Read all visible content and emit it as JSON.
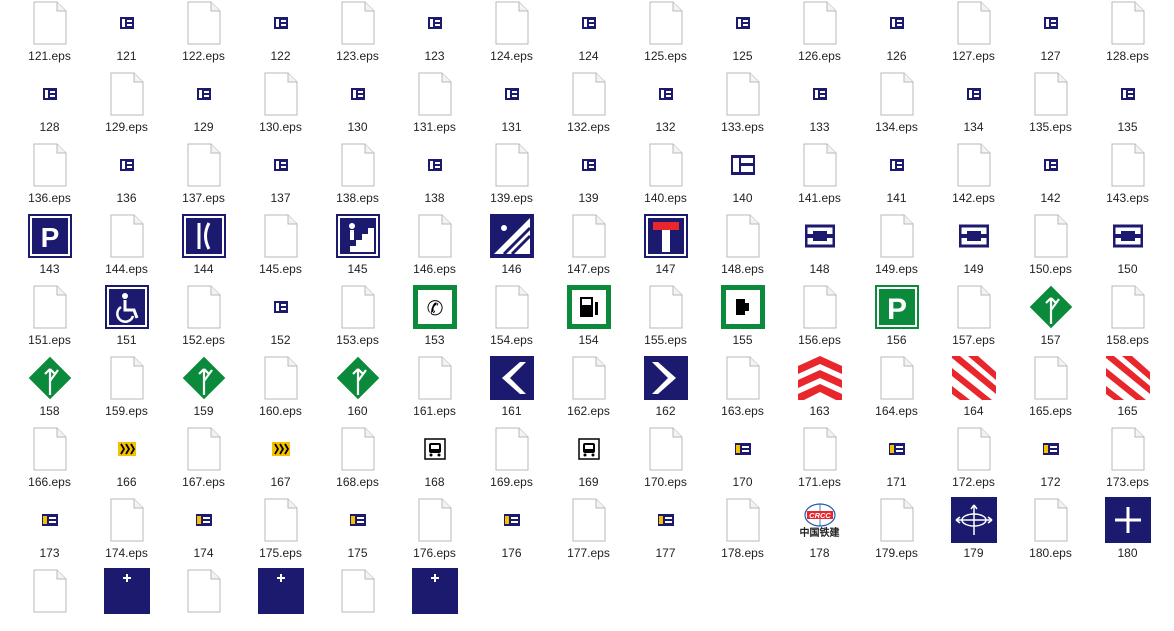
{
  "rows": [
    [
      {
        "l": "121.eps",
        "t": "file"
      },
      {
        "l": "121",
        "t": "smallnav"
      },
      {
        "l": "122.eps",
        "t": "file"
      },
      {
        "l": "122",
        "t": "smallnav"
      },
      {
        "l": "123.eps",
        "t": "file"
      },
      {
        "l": "123",
        "t": "smallnav"
      },
      {
        "l": "124.eps",
        "t": "file"
      },
      {
        "l": "124",
        "t": "smallnav"
      },
      {
        "l": "125.eps",
        "t": "file"
      },
      {
        "l": "125",
        "t": "smallnav"
      },
      {
        "l": "126.eps",
        "t": "file"
      },
      {
        "l": "126",
        "t": "smallnav"
      },
      {
        "l": "127.eps",
        "t": "file"
      },
      {
        "l": "127",
        "t": "smallnav"
      },
      {
        "l": "128.eps",
        "t": "file"
      }
    ],
    [
      {
        "l": "128",
        "t": "smallnav"
      },
      {
        "l": "129.eps",
        "t": "file"
      },
      {
        "l": "129",
        "t": "smallnav"
      },
      {
        "l": "130.eps",
        "t": "file"
      },
      {
        "l": "130",
        "t": "smallnav"
      },
      {
        "l": "131.eps",
        "t": "file"
      },
      {
        "l": "131",
        "t": "smallnav"
      },
      {
        "l": "132.eps",
        "t": "file"
      },
      {
        "l": "132",
        "t": "smallnav"
      },
      {
        "l": "133.eps",
        "t": "file"
      },
      {
        "l": "133",
        "t": "smallnav"
      },
      {
        "l": "134.eps",
        "t": "file"
      },
      {
        "l": "134",
        "t": "smallnav"
      },
      {
        "l": "135.eps",
        "t": "file"
      },
      {
        "l": "135",
        "t": "smallnav"
      }
    ],
    [
      {
        "l": "136.eps",
        "t": "file"
      },
      {
        "l": "136",
        "t": "smallnav"
      },
      {
        "l": "137.eps",
        "t": "file"
      },
      {
        "l": "137",
        "t": "smallnav"
      },
      {
        "l": "138.eps",
        "t": "file"
      },
      {
        "l": "138",
        "t": "smallnav"
      },
      {
        "l": "139.eps",
        "t": "file"
      },
      {
        "l": "139",
        "t": "smallnav"
      },
      {
        "l": "140.eps",
        "t": "file"
      },
      {
        "l": "140",
        "t": "midnav"
      },
      {
        "l": "141.eps",
        "t": "file"
      },
      {
        "l": "141",
        "t": "smallnav"
      },
      {
        "l": "142.eps",
        "t": "file"
      },
      {
        "l": "142",
        "t": "smallnav"
      },
      {
        "l": "143.eps",
        "t": "file"
      }
    ],
    [
      {
        "l": "143",
        "t": "parking-blue"
      },
      {
        "l": "144.eps",
        "t": "file"
      },
      {
        "l": "144",
        "t": "curve-blue"
      },
      {
        "l": "145.eps",
        "t": "file"
      },
      {
        "l": "145",
        "t": "stairs-up"
      },
      {
        "l": "146.eps",
        "t": "file"
      },
      {
        "l": "146",
        "t": "stairs-diag"
      },
      {
        "l": "147.eps",
        "t": "file"
      },
      {
        "l": "147",
        "t": "deadend"
      },
      {
        "l": "148.eps",
        "t": "file"
      },
      {
        "l": "148",
        "t": "interchange"
      },
      {
        "l": "149.eps",
        "t": "file"
      },
      {
        "l": "149",
        "t": "interchange"
      },
      {
        "l": "150.eps",
        "t": "file"
      },
      {
        "l": "150",
        "t": "interchange"
      }
    ],
    [
      {
        "l": "151.eps",
        "t": "file"
      },
      {
        "l": "151",
        "t": "wheelchair"
      },
      {
        "l": "152.eps",
        "t": "file"
      },
      {
        "l": "152",
        "t": "smallnav"
      },
      {
        "l": "153.eps",
        "t": "file"
      },
      {
        "l": "153",
        "t": "phone-green"
      },
      {
        "l": "154.eps",
        "t": "file"
      },
      {
        "l": "154",
        "t": "fuel-green"
      },
      {
        "l": "155.eps",
        "t": "file"
      },
      {
        "l": "155",
        "t": "food-green"
      },
      {
        "l": "156.eps",
        "t": "file"
      },
      {
        "l": "156",
        "t": "parking-green"
      },
      {
        "l": "157.eps",
        "t": "file"
      },
      {
        "l": "157",
        "t": "diamond-green"
      },
      {
        "l": "158.eps",
        "t": "file"
      }
    ],
    [
      {
        "l": "158",
        "t": "diamond-green"
      },
      {
        "l": "159.eps",
        "t": "file"
      },
      {
        "l": "159",
        "t": "diamond-green"
      },
      {
        "l": "160.eps",
        "t": "file"
      },
      {
        "l": "160",
        "t": "diamond-green"
      },
      {
        "l": "161.eps",
        "t": "file"
      },
      {
        "l": "161",
        "t": "chevron-left"
      },
      {
        "l": "162.eps",
        "t": "file"
      },
      {
        "l": "162",
        "t": "chevron-right"
      },
      {
        "l": "163.eps",
        "t": "file"
      },
      {
        "l": "163",
        "t": "red-chevron"
      },
      {
        "l": "164.eps",
        "t": "file"
      },
      {
        "l": "164",
        "t": "red-stripe"
      },
      {
        "l": "165.eps",
        "t": "file"
      },
      {
        "l": "165",
        "t": "red-stripe"
      }
    ],
    [
      {
        "l": "166.eps",
        "t": "file"
      },
      {
        "l": "166",
        "t": "yellow-small"
      },
      {
        "l": "167.eps",
        "t": "file"
      },
      {
        "l": "167",
        "t": "yellow-small"
      },
      {
        "l": "168.eps",
        "t": "file"
      },
      {
        "l": "168",
        "t": "bus-small"
      },
      {
        "l": "169.eps",
        "t": "file"
      },
      {
        "l": "169",
        "t": "bus-small"
      },
      {
        "l": "170.eps",
        "t": "file"
      },
      {
        "l": "170",
        "t": "smallnav-y"
      },
      {
        "l": "171.eps",
        "t": "file"
      },
      {
        "l": "171",
        "t": "smallnav-y"
      },
      {
        "l": "172.eps",
        "t": "file"
      },
      {
        "l": "172",
        "t": "smallnav-y"
      },
      {
        "l": "173.eps",
        "t": "file"
      }
    ],
    [
      {
        "l": "173",
        "t": "smallnav-y"
      },
      {
        "l": "174.eps",
        "t": "file"
      },
      {
        "l": "174",
        "t": "smallnav-y"
      },
      {
        "l": "175.eps",
        "t": "file"
      },
      {
        "l": "175",
        "t": "smallnav-y"
      },
      {
        "l": "176.eps",
        "t": "file"
      },
      {
        "l": "176",
        "t": "smallnav-y"
      },
      {
        "l": "177.eps",
        "t": "file"
      },
      {
        "l": "177",
        "t": "smallnav-y"
      },
      {
        "l": "178.eps",
        "t": "file"
      },
      {
        "l": "178",
        "t": "logo",
        "logo_text": "中国铁建",
        "logo_mark": "CRCC"
      },
      {
        "l": "179.eps",
        "t": "file"
      },
      {
        "l": "179",
        "t": "roundabout"
      },
      {
        "l": "180.eps",
        "t": "file"
      },
      {
        "l": "180",
        "t": "plus-blue"
      }
    ],
    [
      {
        "l": "",
        "t": "file"
      },
      {
        "l": "",
        "t": "blue-partial"
      },
      {
        "l": "",
        "t": "file"
      },
      {
        "l": "",
        "t": "blue-partial"
      },
      {
        "l": "",
        "t": "file"
      },
      {
        "l": "",
        "t": "blue-partial"
      }
    ]
  ],
  "colors": {
    "navy": "#1c1a6e",
    "green": "#0a8a3a",
    "red": "#e8262b",
    "yellow": "#f6c200"
  }
}
